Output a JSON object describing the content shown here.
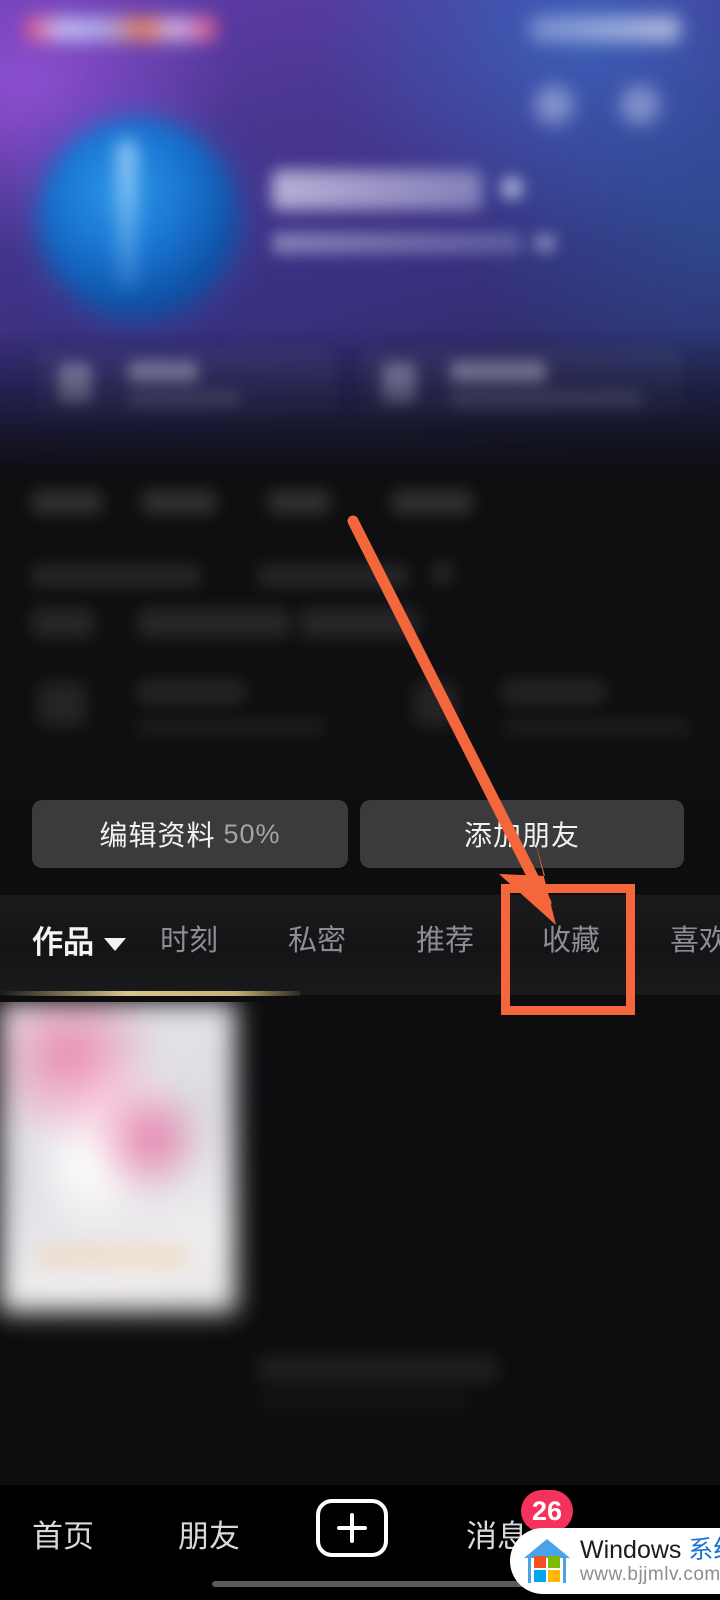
{
  "app": {
    "screen_name": "douyin-profile",
    "accent_annotation_color": "#f4663c",
    "badge_color": "#f5325b",
    "tab_underline_color": "#d8c48a"
  },
  "profile_actions": {
    "edit_profile_label": "编辑资料",
    "edit_profile_progress": "50%",
    "add_friend_label": "添加朋友"
  },
  "tabs": {
    "items": [
      {
        "label": "作品",
        "active": true,
        "has_caret": true
      },
      {
        "label": "时刻",
        "active": false,
        "has_caret": false
      },
      {
        "label": "私密",
        "active": false,
        "has_caret": false
      },
      {
        "label": "推荐",
        "active": false,
        "has_caret": false
      },
      {
        "label": "收藏",
        "active": false,
        "has_caret": false,
        "highlighted": true
      },
      {
        "label": "喜欢",
        "active": false,
        "has_caret": false
      }
    ]
  },
  "bottom_nav": {
    "items": [
      {
        "label": "首页"
      },
      {
        "label": "朋友"
      },
      {
        "label": "消息",
        "badge": "26"
      }
    ],
    "create_icon": "plus-icon"
  },
  "watermark": {
    "brand": "Windows ",
    "brand_cn": "系统之家",
    "url": "www.bjjmlv.com"
  },
  "annotation": {
    "target_tab": "收藏",
    "shape": "red-rect-with-arrow"
  }
}
